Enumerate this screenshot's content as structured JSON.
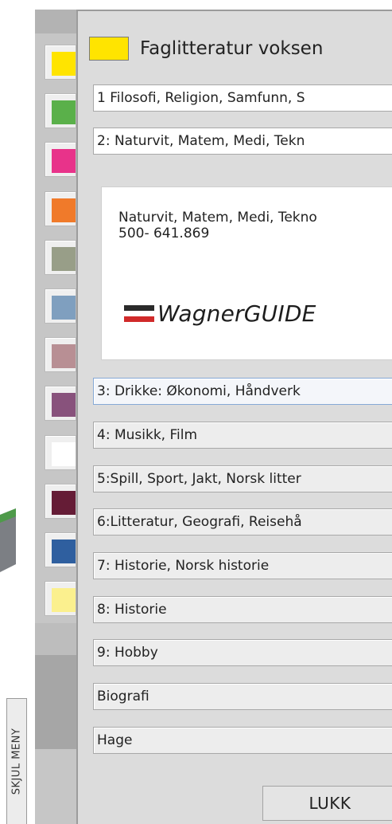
{
  "hide_menu_label": "SKJUL MENY",
  "swatches": [
    {
      "name": "yellow",
      "color": "#ffe400"
    },
    {
      "name": "green",
      "color": "#5ab04a"
    },
    {
      "name": "pink",
      "color": "#e8338a"
    },
    {
      "name": "orange",
      "color": "#f07a2a"
    },
    {
      "name": "olive-gray",
      "color": "#989e88"
    },
    {
      "name": "steel-blue",
      "color": "#7f9fbf"
    },
    {
      "name": "dusty-rose",
      "color": "#b88f94"
    },
    {
      "name": "purple",
      "color": "#88527c"
    },
    {
      "name": "white",
      "color": "#ffffff"
    },
    {
      "name": "burgundy",
      "color": "#651c36"
    },
    {
      "name": "blue",
      "color": "#2f5f9f"
    },
    {
      "name": "light-yellow",
      "color": "#fbf08e"
    }
  ],
  "dialog": {
    "title": "Faglitteratur voksen",
    "title_color": "#ffe400",
    "items": [
      {
        "label": "1 Filosofi, Religion, Samfunn, S"
      },
      {
        "label": "2: Naturvit, Matem, Medi, Tekn"
      },
      {
        "label": "3: Drikke: Økonomi, Håndverk"
      },
      {
        "label": "4: Musikk, Film"
      },
      {
        "label": "5:Spill, Sport, Jakt, Norsk litter"
      },
      {
        "label": "6:Litteratur, Geografi, Reisehå"
      },
      {
        "label": "7: Historie, Norsk historie"
      },
      {
        "label": "8: Historie"
      },
      {
        "label": "9: Hobby"
      },
      {
        "label": "Biografi"
      },
      {
        "label": "Hage"
      }
    ],
    "detail": {
      "name": "Naturvit, Matem, Medi, Tekno",
      "range": "500- 641.869",
      "brand": "WagnerGUIDE",
      "flag_colors": [
        "#2a2a2a",
        "#ffffff",
        "#d02a2a"
      ]
    },
    "close_label": "LUKK"
  }
}
